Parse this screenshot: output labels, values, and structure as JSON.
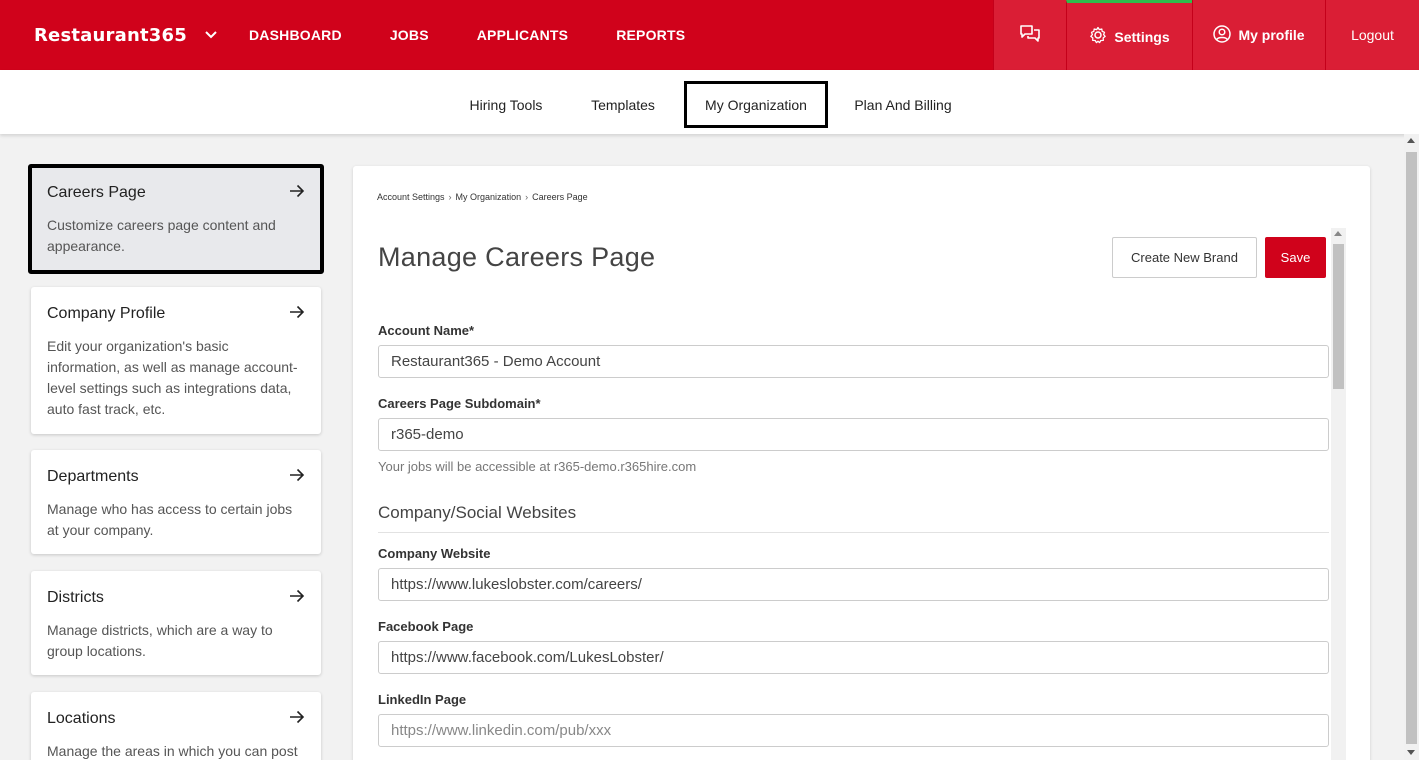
{
  "topbar": {
    "brand": "Restaurant365",
    "nav": [
      "DASHBOARD",
      "JOBS",
      "APPLICANTS",
      "REPORTS"
    ],
    "settings_label": "Settings",
    "profile_label": "My profile",
    "logout_label": "Logout"
  },
  "subnav": {
    "hiring_tools": "Hiring Tools",
    "templates": "Templates",
    "my_organization": "My Organization",
    "plan_billing": "Plan And Billing"
  },
  "sidebar": {
    "cards": [
      {
        "title": "Careers Page",
        "desc": "Customize careers page content and appearance."
      },
      {
        "title": "Company Profile",
        "desc": "Edit your organization's basic information, as well as manage account-level settings such as integrations data, auto fast track, etc."
      },
      {
        "title": "Departments",
        "desc": "Manage who has access to certain jobs at your company."
      },
      {
        "title": "Districts",
        "desc": "Manage districts, which are a way to group locations."
      },
      {
        "title": "Locations",
        "desc": "Manage the areas in which you can post"
      }
    ]
  },
  "main": {
    "breadcrumb": [
      "Account Settings",
      "My Organization",
      "Careers Page"
    ],
    "title": "Manage Careers Page",
    "create_brand_label": "Create New Brand",
    "save_label": "Save",
    "account_name_label": "Account Name*",
    "account_name_value": "Restaurant365 - Demo Account",
    "subdomain_label": "Careers Page Subdomain*",
    "subdomain_value": "r365-demo",
    "subdomain_hint": "Your jobs will be accessible at r365-demo.r365hire.com",
    "social_section": "Company/Social Websites",
    "company_website_label": "Company Website",
    "company_website_value": "https://www.lukeslobster.com/careers/",
    "facebook_label": "Facebook Page",
    "facebook_value": "https://www.facebook.com/LukesLobster/",
    "linkedin_label": "LinkedIn Page",
    "linkedin_placeholder": "https://www.linkedin.com/pub/xxx"
  },
  "colors": {
    "brand_red": "#d0021b",
    "active_tab_indicator": "#2fbd4c"
  }
}
